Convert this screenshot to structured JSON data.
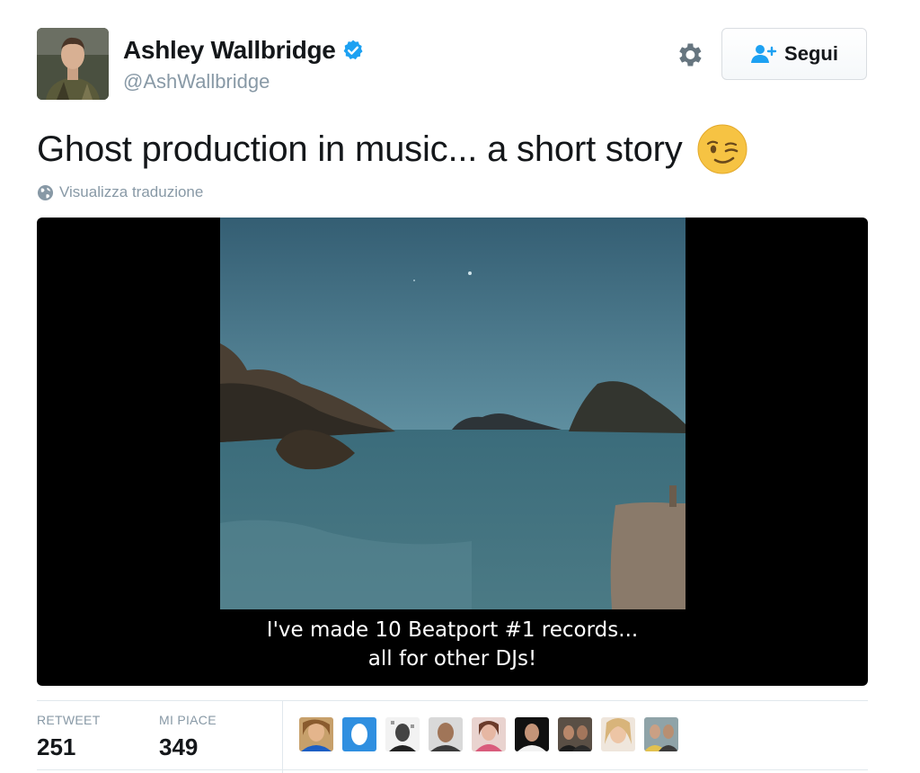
{
  "user": {
    "display_name": "Ashley Wallbridge",
    "handle": "@AshWallbridge",
    "verified": true
  },
  "actions": {
    "settings_icon": "gear-icon",
    "follow_label": "Segui"
  },
  "tweet": {
    "text": "Ghost production in music... a short story",
    "emoji": "winking-face",
    "translate_label": "Visualizza traduzione"
  },
  "video": {
    "subtitle_line1": "I've made 10 Beatport #1 records...",
    "subtitle_line2": "all for other DJs!"
  },
  "stats": {
    "retweets_label": "RETWEET",
    "retweets": "251",
    "likes_label": "MI PIACE",
    "likes": "349"
  },
  "likers": [
    "liker-avatar",
    "liker-avatar",
    "liker-avatar",
    "liker-avatar",
    "liker-avatar",
    "liker-avatar",
    "liker-avatar",
    "liker-avatar",
    "liker-avatar"
  ],
  "colors": {
    "verified_blue": "#1da1f2",
    "muted_text": "#8899a6",
    "follow_icon_blue": "#1da1f2"
  }
}
